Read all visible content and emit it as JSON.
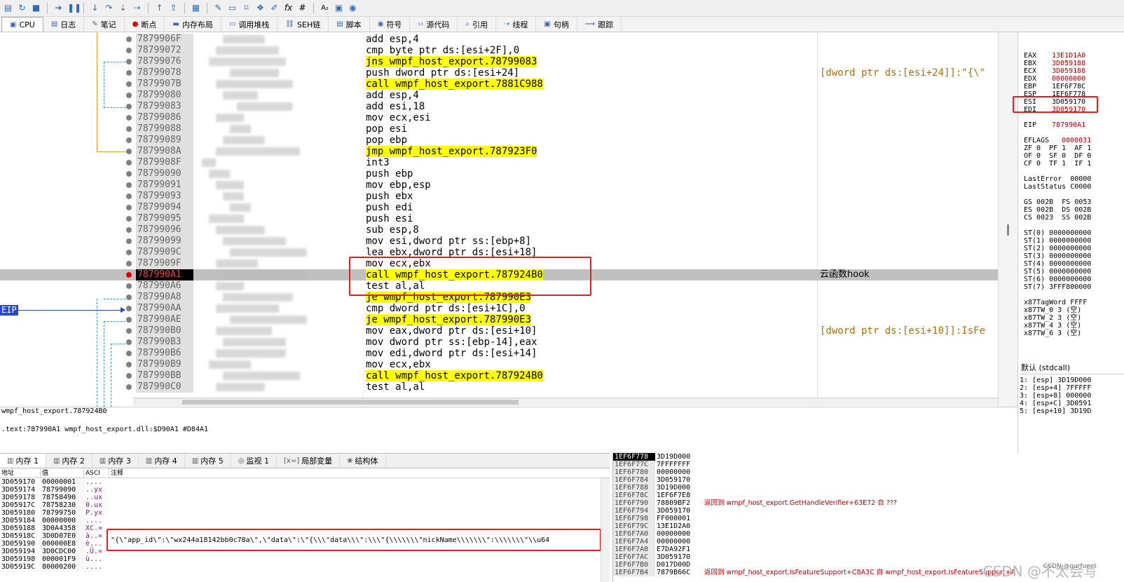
{
  "toolbar": {
    "icons": [
      "open-icon",
      "restart-icon",
      "stop-icon",
      "run-icon",
      "pause-icon",
      "step-into-icon",
      "step-over-icon",
      "trace-into-icon",
      "trace-over-icon",
      "execute-till-return-icon",
      "run-to-user-code-icon",
      "scylla-icon",
      "patch-icon",
      "comment-icon",
      "label-icon",
      "bookmark-icon",
      "highlight-icon",
      "fx-icon",
      "hash-icon",
      "font-icon",
      "calculator-icon",
      "about-icon"
    ],
    "fx_label": "fx",
    "hash_label": "#",
    "font_label": "A₂"
  },
  "tabs": [
    {
      "label": "CPU",
      "icon": "cpu-icon",
      "active": true
    },
    {
      "label": "日志",
      "icon": "log-icon"
    },
    {
      "label": "笔记",
      "icon": "notes-icon"
    },
    {
      "label": "断点",
      "icon": "breakpoint-icon"
    },
    {
      "label": "内存布局",
      "icon": "memory-map-icon"
    },
    {
      "label": "调用堆栈",
      "icon": "callstack-icon"
    },
    {
      "label": "SEH链",
      "icon": "seh-icon"
    },
    {
      "label": "脚本",
      "icon": "script-icon"
    },
    {
      "label": "符号",
      "icon": "symbols-icon"
    },
    {
      "label": "源代码",
      "icon": "source-icon"
    },
    {
      "label": "引用",
      "icon": "references-icon"
    },
    {
      "label": "线程",
      "icon": "threads-icon"
    },
    {
      "label": "句柄",
      "icon": "handles-icon"
    },
    {
      "label": "跟踪",
      "icon": "trace-icon"
    }
  ],
  "disasm": {
    "eip_label": "EIP",
    "rows": [
      {
        "addr": "7879906F",
        "instr": "add esp,4"
      },
      {
        "addr": "78799072",
        "instr": "cmp byte ptr ds:[esi+2F],0"
      },
      {
        "addr": "78799076",
        "instr": "jns wmpf_host_export.78799083",
        "hl": "jump"
      },
      {
        "addr": "78799078",
        "instr": "push dword ptr ds:[esi+24]",
        "cmt": "[dword ptr ds:[esi+24]]:\"{\\\""
      },
      {
        "addr": "7879907B",
        "instr": "call wmpf_host_export.7881C988",
        "hl": "call"
      },
      {
        "addr": "78799080",
        "instr": "add esp,4"
      },
      {
        "addr": "78799083",
        "instr": "add esi,18"
      },
      {
        "addr": "78799086",
        "instr": "mov ecx,esi"
      },
      {
        "addr": "78799088",
        "instr": "pop esi"
      },
      {
        "addr": "78799089",
        "instr": "pop ebp"
      },
      {
        "addr": "7879908A",
        "instr": "jmp wmpf_host_export.787923F0",
        "hl": "jump"
      },
      {
        "addr": "7879908F",
        "instr": "int3"
      },
      {
        "addr": "78799090",
        "instr": "push ebp"
      },
      {
        "addr": "78799091",
        "instr": "mov ebp,esp"
      },
      {
        "addr": "78799093",
        "instr": "push ebx"
      },
      {
        "addr": "78799094",
        "instr": "push edi"
      },
      {
        "addr": "78799095",
        "instr": "push esi"
      },
      {
        "addr": "78799096",
        "instr": "sub esp,8"
      },
      {
        "addr": "78799099",
        "instr": "mov esi,dword ptr ss:[ebp+8]",
        "hl": "ss"
      },
      {
        "addr": "7879909C",
        "instr": "lea ebx,dword ptr ds:[esi+18]"
      },
      {
        "addr": "7879909F",
        "instr": "mov ecx,ebx"
      },
      {
        "addr": "787990A1",
        "instr": "call wmpf_host_export.787924B0",
        "hl": "call",
        "eip": true,
        "cmt": "云函数hook"
      },
      {
        "addr": "787990A6",
        "instr": "test al,al"
      },
      {
        "addr": "787990A8",
        "instr": "je wmpf_host_export.787990E3",
        "hl": "jump"
      },
      {
        "addr": "787990AA",
        "instr": "cmp dword ptr ds:[esi+1C],0"
      },
      {
        "addr": "787990AE",
        "instr": "je wmpf_host_export.787990E3",
        "hl": "jump"
      },
      {
        "addr": "787990B0",
        "instr": "mov eax,dword ptr ds:[esi+10]",
        "cmt": "[dword ptr ds:[esi+10]]:IsFe"
      },
      {
        "addr": "787990B3",
        "instr": "mov dword ptr ss:[ebp-14],eax",
        "hl": "ss"
      },
      {
        "addr": "787990B6",
        "instr": "mov edi,dword ptr ds:[esi+14]"
      },
      {
        "addr": "787990B9",
        "instr": "mov ecx,ebx"
      },
      {
        "addr": "787990BB",
        "instr": "call wmpf_host_export.787924B0",
        "hl": "call"
      },
      {
        "addr": "787990C0",
        "instr": "test al,al"
      }
    ]
  },
  "registers": {
    "rows": [
      {
        "name": "EAX",
        "value": "13E1D1A0"
      },
      {
        "name": "EBX",
        "value": "3D059188"
      },
      {
        "name": "ECX",
        "value": "3D059188"
      },
      {
        "name": "EDX",
        "value": "00000000"
      },
      {
        "name": "EBP",
        "value": "1EF6F78C"
      },
      {
        "name": "ESP",
        "value": "1EF6F778"
      },
      {
        "name": "ESI",
        "value": "3D059170"
      },
      {
        "name": "EDI",
        "value": "3D059170"
      }
    ],
    "eip": {
      "name": "EIP",
      "value": "787990A1"
    },
    "eflags": {
      "name": "EFLAGS",
      "value": "0000031"
    },
    "flags": [
      "ZF 0  PF 1  AF 1",
      "OF 0  SF 0  DF 0",
      "CF 0  TF 1  IF 1"
    ],
    "last_error": "LastError  00000",
    "last_status": "LastStatus C0000",
    "segs": [
      "GS 002B  FS 0053",
      "ES 002B  DS 002B",
      "CS 0023  SS 002B"
    ],
    "fpu": [
      "ST(0) 0000000000",
      "ST(1) 0000000000",
      "ST(2) 0000000000",
      "ST(3) 0000000000",
      "ST(4) 0000000000",
      "ST(5) 0000000000",
      "ST(6) 0000000000",
      "ST(7) 3FFF800000"
    ],
    "tag": [
      "x87TagWord FFFF",
      "x87TW_0 3 (空)",
      "x87TW_2 3 (空)",
      "x87TW_4 3 (空)",
      "x87TW_6 3 (空)"
    ]
  },
  "callconv": {
    "header": "默认 (stdcall)",
    "rows": [
      "1: [esp] 3D19D000",
      "2: [esp+4] 7FFFFF",
      "3: [esp+8] 000000",
      "4: [esp+C] 3D0591",
      "5: [esp+10] 3D19D"
    ]
  },
  "info": {
    "line1": "wmpf_host_export.787924B0",
    "line2": ".text:787990A1 wmpf_host_export.dll:$D90A1 #D84A1"
  },
  "memtabs": [
    {
      "label": "内存 1",
      "icon": "memory-icon",
      "active": true
    },
    {
      "label": "内存 2",
      "icon": "memory-icon"
    },
    {
      "label": "内存 3",
      "icon": "memory-icon"
    },
    {
      "label": "内存 4",
      "icon": "memory-icon"
    },
    {
      "label": "内存 5",
      "icon": "memory-icon"
    },
    {
      "label": "监视 1",
      "icon": "watch-icon"
    },
    {
      "label": "局部变量",
      "icon": "locals-icon"
    },
    {
      "label": "结构体",
      "icon": "struct-icon"
    }
  ],
  "memgrid": {
    "headers": [
      "地址",
      "值",
      "ASCI",
      "注释"
    ],
    "rows": [
      {
        "a": "3D059170",
        "v": "00000001",
        "s": "...."
      },
      {
        "a": "3D059174",
        "v": "78799090",
        "s": "..yx"
      },
      {
        "a": "3D059178",
        "v": "78758490",
        "s": "..ux"
      },
      {
        "a": "3D05917C",
        "v": "78758230",
        "s": "0.ux"
      },
      {
        "a": "3D059180",
        "v": "78799750",
        "s": "P.yx"
      },
      {
        "a": "3D059184",
        "v": "00000000",
        "s": "...."
      },
      {
        "a": "3D059188",
        "v": "3D0A4358",
        "s": "XC.="
      },
      {
        "a": "3D05918C",
        "v": "3D0D07E0",
        "s": "à..="
      },
      {
        "a": "3D059190",
        "v": "000000E8",
        "s": "è..."
      },
      {
        "a": "3D059194",
        "v": "3D0CDC00",
        "s": ".Ü.="
      },
      {
        "a": "3D059198",
        "v": "000001F9",
        "s": "ù..."
      },
      {
        "a": "3D05919C",
        "v": "80000200",
        "s": "...."
      }
    ],
    "comment": "\"{\\\"app_id\\\":\\\"wx244a18142bb0c78a\\\",\\\"data\\\":\\\"{\\\\\\\"data\\\\\\\":\\\\\\\"{\\\\\\\\\\\\\\\"nickName\\\\\\\\\\\\\\\":\\\\\\\\\\\\\\\"\\\\u64"
  },
  "stack": {
    "rows": [
      {
        "a": "1EF6F778",
        "v": "3D19D000",
        "c": ""
      },
      {
        "a": "1EF6F77C",
        "v": "7FFFFFFF",
        "c": ""
      },
      {
        "a": "1EF6F780",
        "v": "00000000",
        "c": ""
      },
      {
        "a": "1EF6F784",
        "v": "3D059170",
        "c": ""
      },
      {
        "a": "1EF6F788",
        "v": "3D19D000",
        "c": ""
      },
      {
        "a": "1EF6F78C",
        "v": "1EF6F7E8",
        "c": ""
      },
      {
        "a": "1EF6F790",
        "v": "78809BF2",
        "c": "返回到 wmpf_host_export.GetHandleVerifier+63E72 自 ???"
      },
      {
        "a": "1EF6F794",
        "v": "3D059170",
        "c": ""
      },
      {
        "a": "1EF6F798",
        "v": "FF000001",
        "c": ""
      },
      {
        "a": "1EF6F79C",
        "v": "13E1D2A0",
        "c": ""
      },
      {
        "a": "1EF6F7A0",
        "v": "00000000",
        "c": ""
      },
      {
        "a": "1EF6F7A4",
        "v": "00000000",
        "c": ""
      },
      {
        "a": "1EF6F7A8",
        "v": "E7DA92F1",
        "c": ""
      },
      {
        "a": "1EF6F7AC",
        "v": "3D059170",
        "c": ""
      },
      {
        "a": "1EF6F7B0",
        "v": "D017D00D",
        "c": ""
      },
      {
        "a": "1EF6F7B4",
        "v": "7879B66C",
        "c": "返回到 wmpf_host_export.IsFeatureSupport+C8A3C 自 wmpf_host_export.IsFeatureSupport+A"
      }
    ]
  },
  "watermark": "CSDN @不太会写",
  "watermark_small": "CSDN @garfunel"
}
